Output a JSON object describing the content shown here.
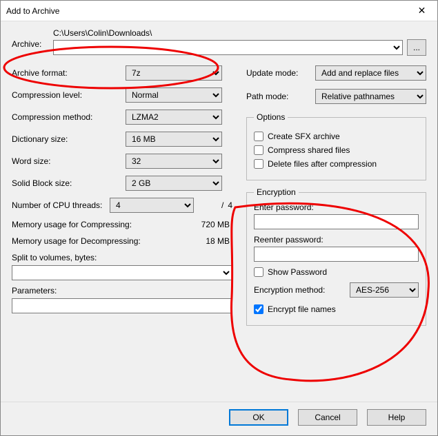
{
  "window": {
    "title": "Add to Archive"
  },
  "archive": {
    "label": "Archive:",
    "path": "C:\\Users\\Colin\\Downloads\\",
    "value": "",
    "browse": "..."
  },
  "left": {
    "format": {
      "label": "Archive format:",
      "value": "7z"
    },
    "level": {
      "label": "Compression level:",
      "value": "Normal"
    },
    "method": {
      "label": "Compression method:",
      "value": "LZMA2"
    },
    "dict": {
      "label": "Dictionary size:",
      "value": "16 MB"
    },
    "word": {
      "label": "Word size:",
      "value": "32"
    },
    "block": {
      "label": "Solid Block size:",
      "value": "2 GB"
    },
    "threads": {
      "label": "Number of CPU threads:",
      "value": "4",
      "max_prefix": "/",
      "max": "4"
    },
    "mem_compress": {
      "label": "Memory usage for Compressing:",
      "value": "720 MB"
    },
    "mem_decompress": {
      "label": "Memory usage for Decompressing:",
      "value": "18 MB"
    },
    "split": {
      "label": "Split to volumes, bytes:",
      "value": ""
    },
    "params": {
      "label": "Parameters:",
      "value": ""
    }
  },
  "right": {
    "update": {
      "label": "Update mode:",
      "value": "Add and replace files"
    },
    "path": {
      "label": "Path mode:",
      "value": "Relative pathnames"
    },
    "options": {
      "legend": "Options",
      "sfx": "Create SFX archive",
      "shared": "Compress shared files",
      "delete": "Delete files after compression"
    },
    "enc": {
      "legend": "Encryption",
      "enter": "Enter password:",
      "reenter": "Reenter password:",
      "show": "Show Password",
      "method_label": "Encryption method:",
      "method_value": "AES-256",
      "encrypt_names": "Encrypt file names"
    }
  },
  "buttons": {
    "ok": "OK",
    "cancel": "Cancel",
    "help": "Help"
  }
}
